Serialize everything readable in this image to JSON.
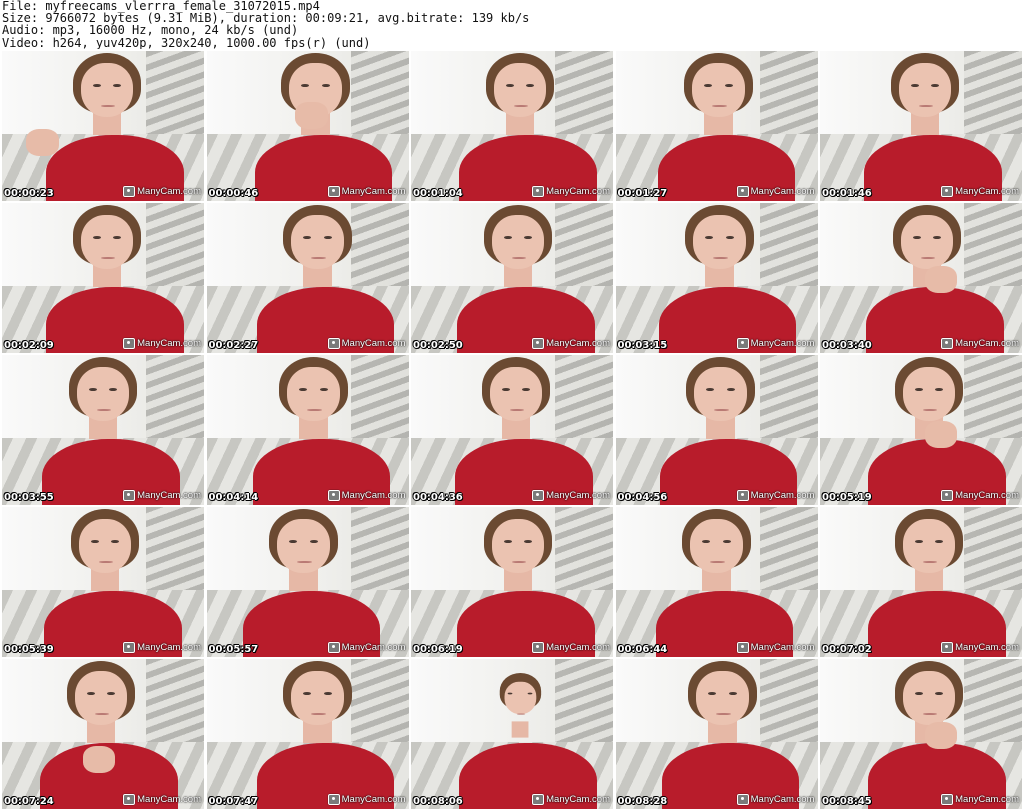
{
  "header": {
    "file": "File: myfreecams_vlerrra_female_31072015.mp4",
    "size": "Size: 9766072 bytes (9.31 MiB), duration: 00:09:21, avg.bitrate: 139 kb/s",
    "audio": "Audio: mp3, 16000 Hz, mono, 24 kb/s (und)",
    "video": "Video: h264, yuv420p, 320x240, 1000.00 fps(r) (und)"
  },
  "watermark": "ManyCam.com",
  "colors": {
    "shirt": "#b81c2b",
    "timestamp_text": "#ffffff",
    "timestamp_outline": "#000000"
  },
  "thumbnails": [
    {
      "timestamp": "00:00:23"
    },
    {
      "timestamp": "00:00:46"
    },
    {
      "timestamp": "00:01:04"
    },
    {
      "timestamp": "00:01:27"
    },
    {
      "timestamp": "00:01:46"
    },
    {
      "timestamp": "00:02:09"
    },
    {
      "timestamp": "00:02:27"
    },
    {
      "timestamp": "00:02:50"
    },
    {
      "timestamp": "00:03:15"
    },
    {
      "timestamp": "00:03:40"
    },
    {
      "timestamp": "00:03:55"
    },
    {
      "timestamp": "00:04:14"
    },
    {
      "timestamp": "00:04:36"
    },
    {
      "timestamp": "00:04:56"
    },
    {
      "timestamp": "00:05:19"
    },
    {
      "timestamp": "00:05:39"
    },
    {
      "timestamp": "00:05:57"
    },
    {
      "timestamp": "00:06:19"
    },
    {
      "timestamp": "00:06:44"
    },
    {
      "timestamp": "00:07:02"
    },
    {
      "timestamp": "00:07:24"
    },
    {
      "timestamp": "00:07:47"
    },
    {
      "timestamp": "00:08:06"
    },
    {
      "timestamp": "00:08:28"
    },
    {
      "timestamp": "00:08:45"
    }
  ]
}
